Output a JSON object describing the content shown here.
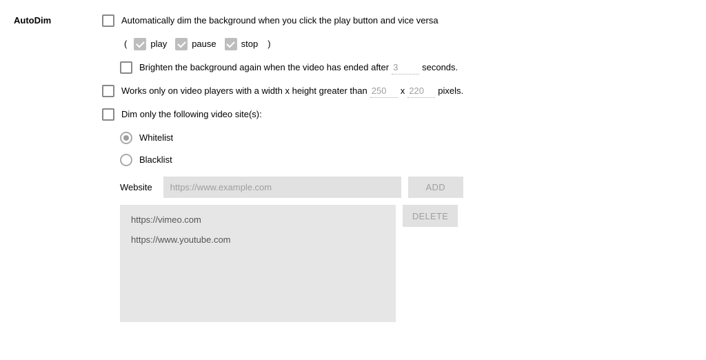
{
  "section_title": "AutoDim",
  "auto_dim": {
    "label": "Automatically dim the background when you click the play button and vice versa",
    "paren_open": "(",
    "paren_close": ")",
    "play_label": "play",
    "pause_label": "pause",
    "stop_label": "stop"
  },
  "brighten": {
    "label_before": "Brighten the background again when the video has ended after",
    "seconds_value": "3",
    "label_after": "seconds."
  },
  "size_filter": {
    "label_before": "Works only on video players with a width x height greater than",
    "width_value": "250",
    "x_label": "x",
    "height_value": "220",
    "label_after": "pixels."
  },
  "site_filter": {
    "label": "Dim only the following video site(s):",
    "whitelist_label": "Whitelist",
    "blacklist_label": "Blacklist"
  },
  "website": {
    "label": "Website",
    "placeholder": "https://www.example.com",
    "add_button": "ADD",
    "delete_button": "DELETE",
    "sites": [
      "https://vimeo.com",
      "https://www.youtube.com"
    ]
  }
}
